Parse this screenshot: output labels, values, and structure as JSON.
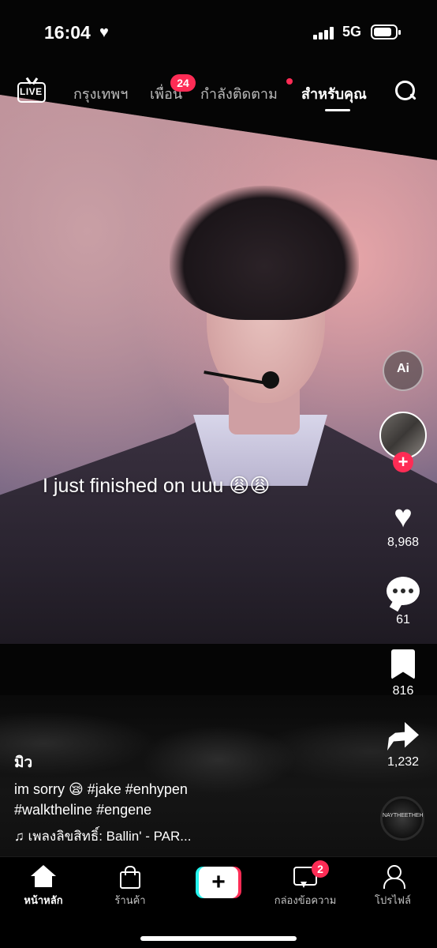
{
  "status_bar": {
    "time": "16:04",
    "network": "5G",
    "battery_level": 0.85
  },
  "top_nav": {
    "live_label": "LIVE",
    "tabs": [
      {
        "label": "กรุงเทพฯ",
        "active": false
      },
      {
        "label": "เพื่อน",
        "active": false,
        "badge": "24"
      },
      {
        "label": "กำลังติดตาม",
        "active": false,
        "dot": true
      },
      {
        "label": "สำหรับคุณ",
        "active": true
      }
    ]
  },
  "video": {
    "overlay_text": "I just finished on uuu 😩😩"
  },
  "right_rail": {
    "ai_label": "Ai",
    "likes": "8,968",
    "comments": "61",
    "saves": "816",
    "shares": "1,232",
    "follow_plus": "+",
    "disc_text": "NAYTHEETHEH"
  },
  "post": {
    "username": "มิว",
    "caption_line1": "im sorry 😪 #jake #enhypen",
    "caption_line2": "#walktheline #engene",
    "sound": "♫ เพลงลิขสิทธิ์: Ballin' - PAR..."
  },
  "bottom_nav": {
    "home": "หน้าหลัก",
    "shop": "ร้านค้า",
    "create": "+",
    "inbox": "กล่องข้อความ",
    "inbox_badge": "2",
    "profile": "โปรไฟล์"
  },
  "colors": {
    "accent": "#fe2c55",
    "cyan": "#25f4ee"
  }
}
